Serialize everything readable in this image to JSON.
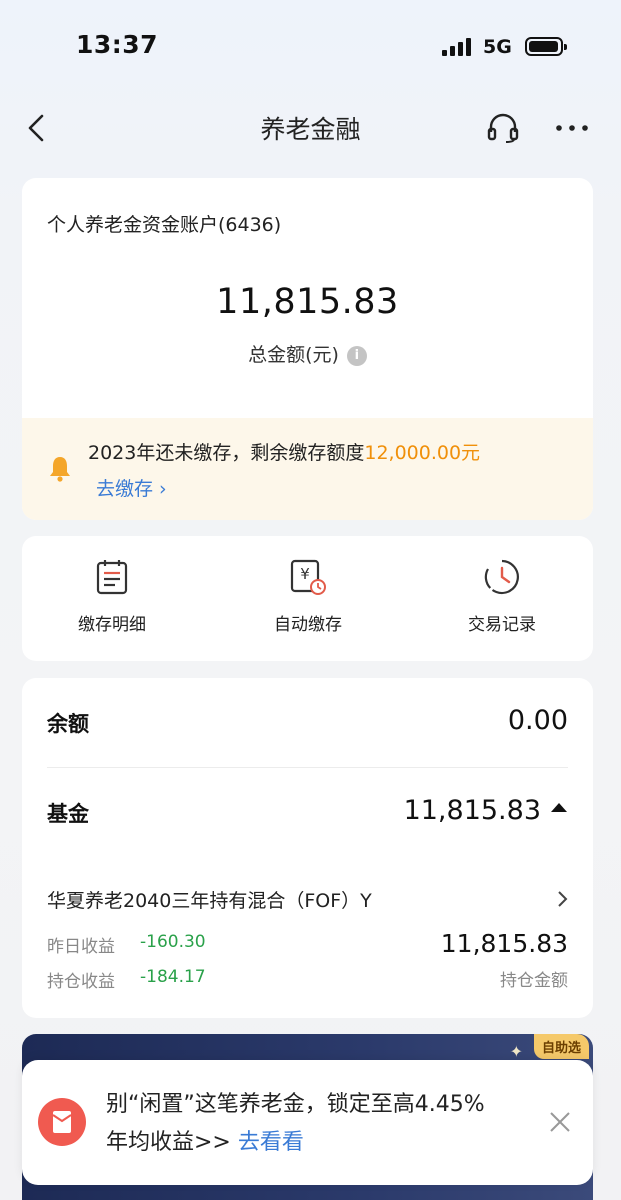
{
  "status_bar": {
    "time": "13:37",
    "network": "5G"
  },
  "nav": {
    "title": "养老金融",
    "back_icon": "chevron-left-icon",
    "service_icon": "headset-icon",
    "more_icon": "more-icon"
  },
  "account": {
    "title": "个人养老金资金账户(6436)",
    "total_amount": "11,815.83",
    "total_label": "总金额(元)",
    "info_icon": "i"
  },
  "notice": {
    "text": "2023年还未缴存，剩余缴存额度",
    "amount": "12,000.00元",
    "link": "去缴存 ›",
    "accent_color": "#f0900a"
  },
  "quick_actions": [
    {
      "label": "缴存明细",
      "icon": "list-document-icon"
    },
    {
      "label": "自动缴存",
      "icon": "yuan-clock-icon"
    },
    {
      "label": "交易记录",
      "icon": "history-clock-icon"
    }
  ],
  "balances": {
    "cash_label": "余额",
    "cash_value": "0.00",
    "fund_label": "基金",
    "fund_value": "11,815.83"
  },
  "fund": {
    "name": "华夏养老2040三年持有混合（FOF）Y",
    "yesterday_label": "昨日收益",
    "yesterday_value": "-160.30",
    "holding_label": "持仓收益",
    "holding_value": "-184.17",
    "amount": "11,815.83",
    "amount_label": "持仓金额",
    "gain_color": "#2aa14a"
  },
  "banner": {
    "tag": "自助选"
  },
  "promo": {
    "text": "别“闲置”这笔养老金，锁定至高4.45%年均收益>>",
    "link": "去看看"
  }
}
